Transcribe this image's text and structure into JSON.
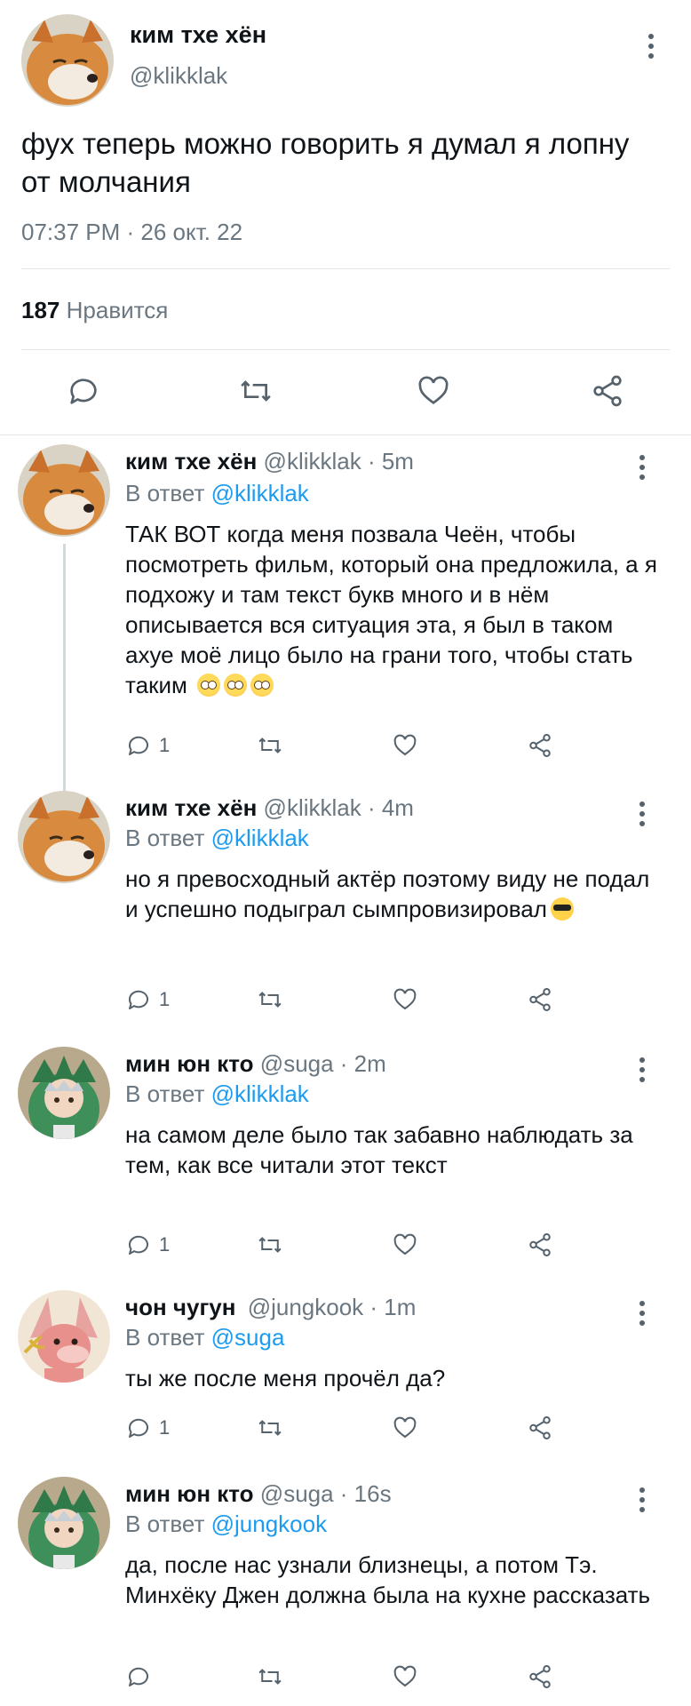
{
  "main_tweet": {
    "author_name": "ким тхе хён",
    "author_handle": "@klikklak",
    "text": "фух теперь можно говорить я думал я лопну от молчания",
    "timestamp": "07:37 PM · 26 окт. 22",
    "likes_count": "187",
    "likes_label": "Нравится",
    "avatar_icon": "shiba-dog-avatar",
    "actions": [
      "reply-icon",
      "retweet-icon",
      "like-icon",
      "share-icon"
    ]
  },
  "replies": [
    {
      "author_name": "ким тхе хён",
      "author_handle": "@klikklak · 5m",
      "reply_prefix": "В ответ",
      "reply_to": "@klikklak",
      "text": "ТАК ВОТ когда меня позвала Чеён, чтобы посмотреть фильм, который она предложила, а я подхожу и там текст букв много и в нём описывается вся ситуация эта, я был в таком ахуе моё лицо было на грани того, чтобы стать таким",
      "emoji": "😳 😳 😳",
      "reply_count": "1"
    },
    {
      "author_name": "ким тхе хён",
      "author_handle": "@klikklak · 4m",
      "reply_prefix": "В ответ",
      "reply_to": "@klikklak",
      "text": "но я превосходный актёр поэтому виду не подал и успешно подыграл сымпровизировал",
      "emoji": "😎",
      "reply_count": "1"
    },
    {
      "author_name": "мин юн кто",
      "author_handle": "@suga · 2m",
      "reply_prefix": "В ответ",
      "reply_to": "@klikklak",
      "text": "на самом деле было так забавно наблюдать за тем, как все читали этот текст",
      "reply_count": "1"
    },
    {
      "author_name": "чон чугун",
      "author_handle": "@jungkook · 1m",
      "reply_prefix": "В ответ",
      "reply_to": "@suga",
      "text": "ты же после меня прочёл да?",
      "reply_count": "1"
    },
    {
      "author_name": "мин юн кто",
      "author_handle": "@suga · 16s",
      "reply_prefix": "В ответ",
      "reply_to": "@jungkook",
      "text": "да, после нас узнали близнецы, а потом Тэ. Минхёку Джен должна была на кухне рассказать",
      "reply_count": ""
    }
  ],
  "colors": {
    "link": "#1d9bf0",
    "muted": "#6b7780",
    "icon": "#55616b",
    "separator": "#e3e7ea"
  }
}
